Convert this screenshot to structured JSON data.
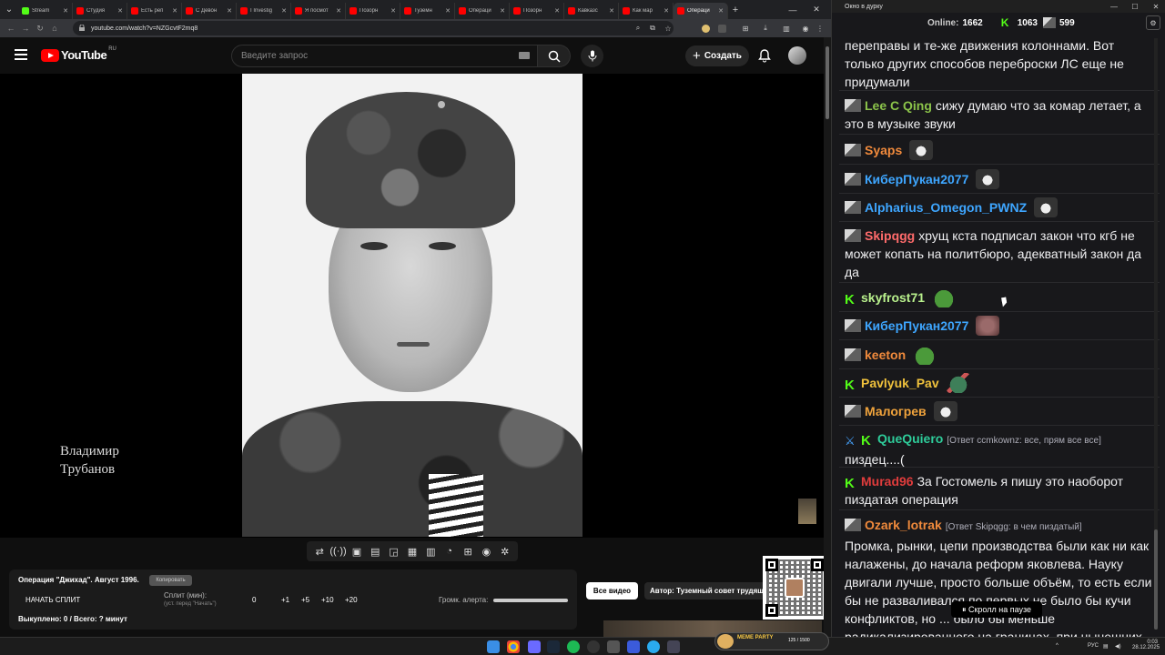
{
  "browser": {
    "tabs": [
      {
        "title": "Stream",
        "color": "#53fc18"
      },
      {
        "title": "Студия",
        "color": "#ff0000"
      },
      {
        "title": "Есть реп",
        "color": "#ff0000"
      },
      {
        "title": "С Девон",
        "color": "#ff0000"
      },
      {
        "title": "I Investig",
        "color": "#ff0000"
      },
      {
        "title": "Я посмот",
        "color": "#ff0000"
      },
      {
        "title": "Позорн",
        "color": "#ff0000"
      },
      {
        "title": "Туземн",
        "color": "#ff0000"
      },
      {
        "title": "Операци",
        "color": "#ff0000"
      },
      {
        "title": "Позорн",
        "color": "#ff0000"
      },
      {
        "title": "Кавказс",
        "color": "#ff0000"
      },
      {
        "title": "Как мар",
        "color": "#ff0000"
      },
      {
        "title": "Операци",
        "color": "#ff0000"
      }
    ],
    "url": "youtube.com/watch?v=NZGcvtF2mq8"
  },
  "youtube": {
    "logo_text": "YouTube",
    "logo_region": "RU",
    "search_placeholder": "Введите запрос",
    "create_label": "Создать",
    "video_caption_line1": "Владимир",
    "video_caption_line2": "Трубанов"
  },
  "split_panel": {
    "title": "Операция \"Джихад\". Август 1996.",
    "copy_label": "Копировать",
    "start_split": "НАЧАТЬ СПЛИТ",
    "split_label": "Сплит (мин):",
    "split_hint": "(уст. перед \"Начать\")",
    "split_value": "0",
    "inc1": "+1",
    "inc5": "+5",
    "inc10": "+10",
    "inc20": "+20",
    "alert_volume_label": "Громк. алерта:",
    "bought": "Выкуплено: 0 / Всего: ? минут"
  },
  "channel_buttons": {
    "all_videos": "Все видео",
    "author": "Автор: Туземный совет трудящи"
  },
  "chat": {
    "window_title": "Окно в дурку",
    "online_label": "Online:",
    "online_value": "1662",
    "kick_count": "1063",
    "twitch_count": "599",
    "scroll_paused": "Скролл на паузе",
    "messages": [
      {
        "nick": "",
        "color": "#efeff1",
        "text": "переправы и те-же движения колоннами. Вот только других способов переброски ЛС еще не придумали"
      },
      {
        "nick": "Lee C Qing",
        "color": "#8bc34a",
        "text": "сижу думаю что за комар летает, а это в музыке звуки"
      },
      {
        "nick": "Syaps",
        "color": "#f08a3c",
        "text": ""
      },
      {
        "nick": "КиберПукан2077",
        "color": "#3ea6ff",
        "text": ""
      },
      {
        "nick": "Alpharius_Omegon_PWNZ",
        "color": "#3ea6ff",
        "text": ""
      },
      {
        "nick": "Skipqgg",
        "color": "#ff6b6b",
        "text": "хрущ кста подписал закон что кгб не может копать на политбюро, адекватный закон да да"
      },
      {
        "nick": "skyfrost71",
        "color": "#b9f18d",
        "text": ""
      },
      {
        "nick": "КиберПукан2077",
        "color": "#3ea6ff",
        "text": ""
      },
      {
        "nick": "keeton",
        "color": "#f08a3c",
        "text": ""
      },
      {
        "nick": "Pavlyuk_Pav",
        "color": "#f0c23c",
        "text": ""
      },
      {
        "nick": "Малогрев",
        "color": "#f0a33c",
        "text": ""
      },
      {
        "nick": "QueQuiero",
        "color": "#2ecc9a",
        "reply": "[Ответ ccmkownz: все, прям все все]",
        "text": "пиздец....("
      },
      {
        "nick": "Murad96",
        "color": "#e03c3c",
        "text": "За Гостомель я пишу это наоборот пиздатая операция"
      },
      {
        "nick": "Ozark_lotrak",
        "color": "#f08a3c",
        "reply": "[Ответ Skipqgg: в чем пиздатый]",
        "text": "Промка, рынки, цепи производства были как ни как налажены, до начала реформ яковлева. Науку двигали лучше, просто больше объём, то есть если бы не разваливался по первых не было бы кучи конфликтов, но ... было бы меньше радикализированного на границах, при нынешних"
      }
    ]
  },
  "taskbar": {
    "meme_party": "MEME PARTY",
    "meme_count": "125 / 1500",
    "lang": "РУС",
    "time": "0:03",
    "date": "28.12.2025"
  }
}
